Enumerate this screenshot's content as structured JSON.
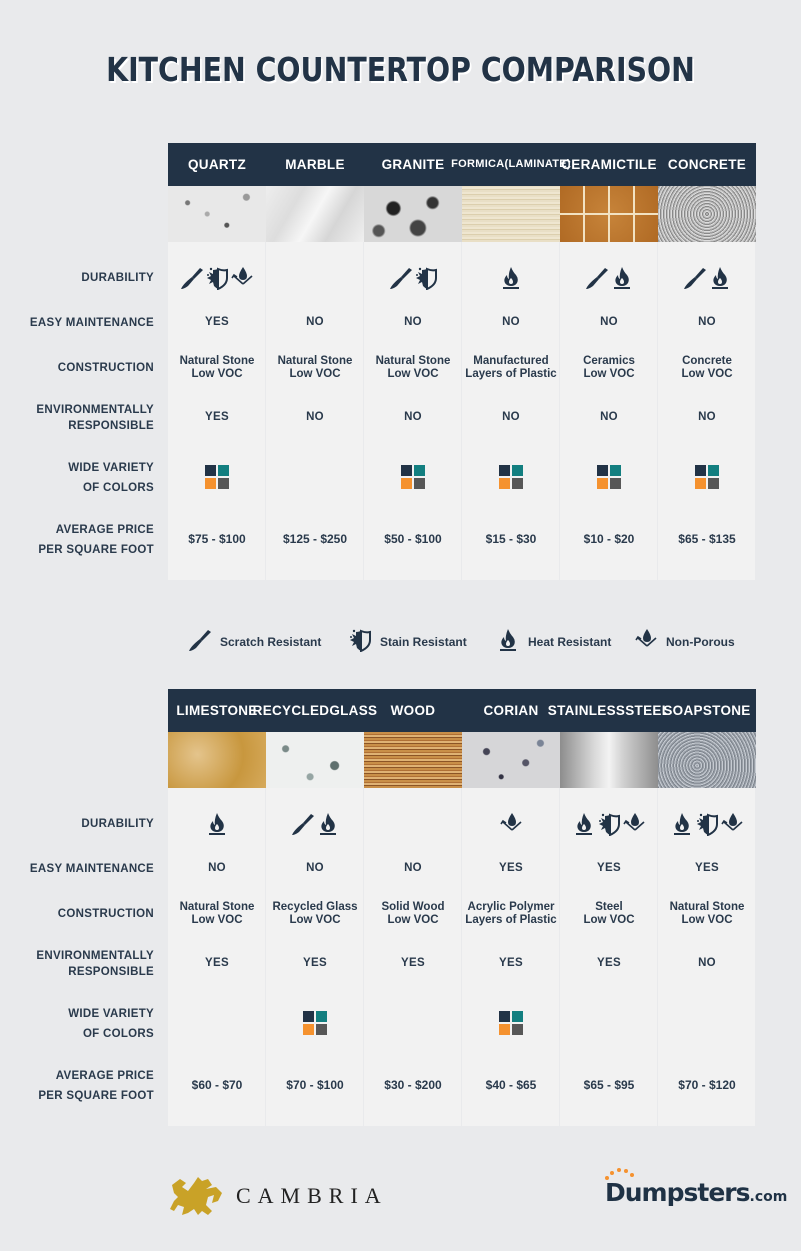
{
  "title": "KITCHEN COUNTERTOP COMPARISON",
  "row_labels": {
    "durability": "DURABILITY",
    "easy_maintenance": "EASY MAINTENANCE",
    "construction": "CONSTRUCTION",
    "env_1": "ENVIRONMENTALLY",
    "env_2": "RESPONSIBLE",
    "colors_1": "WIDE VARIETY",
    "colors_2": "OF COLORS",
    "price_1": "AVERAGE PRICE",
    "price_2": "PER SQUARE FOOT"
  },
  "colors": {
    "header_bg": "#223346",
    "text": "#2a3a4c",
    "swatch_navy": "#223346",
    "swatch_teal": "#137f80",
    "swatch_orange": "#f5922f",
    "swatch_gray": "#575757"
  },
  "tables": [
    {
      "materials": [
        {
          "name_1": "QUARTZ",
          "name_2": "",
          "durability": [
            "scratch",
            "stain",
            "non-porous"
          ],
          "easy_maintenance": "YES",
          "construction_1": "Natural Stone",
          "construction_2": "Low VOC",
          "environmentally_responsible": "YES",
          "wide_variety_of_colors": true,
          "price": "$75 - $100"
        },
        {
          "name_1": "MARBLE",
          "name_2": "",
          "durability": [],
          "easy_maintenance": "NO",
          "construction_1": "Natural Stone",
          "construction_2": "Low VOC",
          "environmentally_responsible": "NO",
          "wide_variety_of_colors": false,
          "price": "$125 - $250"
        },
        {
          "name_1": "GRANITE",
          "name_2": "",
          "durability": [
            "scratch",
            "stain"
          ],
          "easy_maintenance": "NO",
          "construction_1": "Natural Stone",
          "construction_2": "Low VOC",
          "environmentally_responsible": "NO",
          "wide_variety_of_colors": true,
          "price": "$50 - $100"
        },
        {
          "name_1": "FORMICA",
          "name_2": "(LAMINATE)",
          "durability": [
            "heat"
          ],
          "easy_maintenance": "NO",
          "construction_1": "Manufactured",
          "construction_2": "Layers of Plastic",
          "environmentally_responsible": "NO",
          "wide_variety_of_colors": true,
          "price": "$15 - $30"
        },
        {
          "name_1": "CERAMIC",
          "name_2": "TILE",
          "durability": [
            "scratch",
            "heat"
          ],
          "easy_maintenance": "NO",
          "construction_1": "Ceramics",
          "construction_2": "Low VOC",
          "environmentally_responsible": "NO",
          "wide_variety_of_colors": true,
          "price": "$10 - $20"
        },
        {
          "name_1": "CONCRETE",
          "name_2": "",
          "durability": [
            "scratch",
            "heat"
          ],
          "easy_maintenance": "NO",
          "construction_1": "Concrete",
          "construction_2": "Low VOC",
          "environmentally_responsible": "NO",
          "wide_variety_of_colors": true,
          "price": "$65 - $135"
        }
      ]
    },
    {
      "materials": [
        {
          "name_1": "LIMESTONE",
          "name_2": "",
          "durability": [
            "heat"
          ],
          "easy_maintenance": "NO",
          "construction_1": "Natural Stone",
          "construction_2": "Low VOC",
          "environmentally_responsible": "YES",
          "wide_variety_of_colors": false,
          "price": "$60 - $70"
        },
        {
          "name_1": "RECYCLED",
          "name_2": "GLASS",
          "durability": [
            "scratch",
            "heat"
          ],
          "easy_maintenance": "NO",
          "construction_1": "Recycled Glass",
          "construction_2": "Low VOC",
          "environmentally_responsible": "YES",
          "wide_variety_of_colors": true,
          "price": "$70 - $100"
        },
        {
          "name_1": "WOOD",
          "name_2": "",
          "durability": [],
          "easy_maintenance": "NO",
          "construction_1": "Solid Wood",
          "construction_2": "Low VOC",
          "environmentally_responsible": "YES",
          "wide_variety_of_colors": false,
          "price": "$30 - $200"
        },
        {
          "name_1": "CORIAN",
          "name_2": "",
          "durability": [
            "non-porous"
          ],
          "easy_maintenance": "YES",
          "construction_1": "Acrylic Polymer",
          "construction_2": "Layers of Plastic",
          "environmentally_responsible": "YES",
          "wide_variety_of_colors": true,
          "price": "$40 - $65"
        },
        {
          "name_1": "STAINLESS",
          "name_2": "STEEL",
          "durability": [
            "heat",
            "stain",
            "non-porous"
          ],
          "easy_maintenance": "YES",
          "construction_1": "Steel",
          "construction_2": "Low VOC",
          "environmentally_responsible": "YES",
          "wide_variety_of_colors": false,
          "price": "$65 - $95"
        },
        {
          "name_1": "SOAPSTONE",
          "name_2": "",
          "durability": [
            "heat",
            "stain",
            "non-porous"
          ],
          "easy_maintenance": "YES",
          "construction_1": "Natural Stone",
          "construction_2": "Low VOC",
          "environmentally_responsible": "NO",
          "wide_variety_of_colors": false,
          "price": "$70 - $120"
        }
      ]
    }
  ],
  "legend": [
    {
      "icon": "knife-icon",
      "label": "Scratch Resistant"
    },
    {
      "icon": "stain-shield-icon",
      "label": "Stain Resistant"
    },
    {
      "icon": "flame-icon",
      "label": "Heat Resistant"
    },
    {
      "icon": "water-drop-icon",
      "label": "Non-Porous"
    }
  ],
  "footer": {
    "cambria": "CAMBRIA",
    "dumpsters_main": "Dumpsters",
    "dumpsters_suffix": ".com"
  }
}
